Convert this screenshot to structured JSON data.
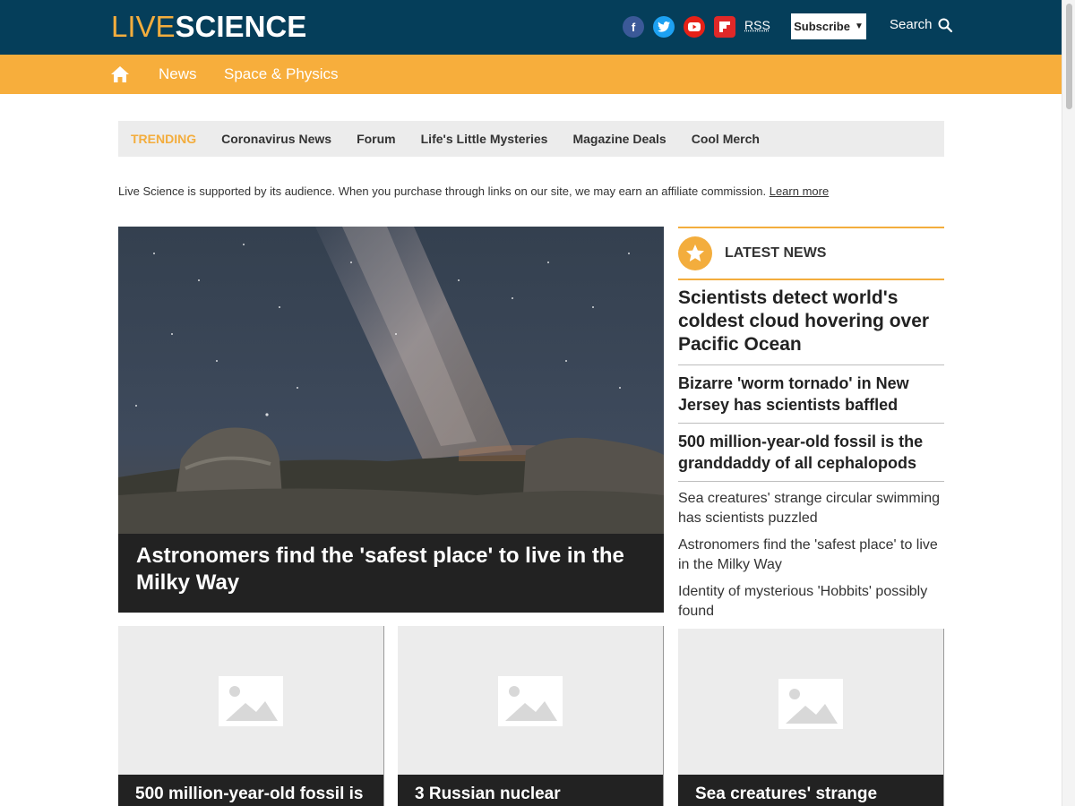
{
  "header": {
    "logo_live": "LIVE",
    "logo_science": "SCIENCE",
    "social": [
      {
        "name": "facebook",
        "glyph": "f",
        "color": "#3b5998"
      },
      {
        "name": "twitter",
        "glyph": "t",
        "color": "#1da1f2"
      },
      {
        "name": "youtube",
        "glyph": "▶",
        "color": "#e62117"
      },
      {
        "name": "flipboard",
        "glyph": "F",
        "color": "#e12828"
      }
    ],
    "rss_label": "RSS",
    "subscribe_label": "Subscribe",
    "search_label": "Search"
  },
  "nav": {
    "items": [
      "News",
      "Space & Physics"
    ]
  },
  "trending": {
    "label": "TRENDING",
    "items": [
      "Coronavirus News",
      "Forum",
      "Life's Little Mysteries",
      "Magazine Deals",
      "Cool Merch"
    ]
  },
  "affiliate": {
    "text": "Live Science is supported by its audience. When you purchase through links on our site, we may earn an affiliate commission.",
    "link": "Learn more"
  },
  "hero": {
    "headline": "Astronomers find the 'safest place' to live in the Milky Way"
  },
  "latest_news": {
    "title": "LATEST NEWS",
    "big_items": [
      "Scientists detect world's coldest cloud hovering over Pacific Ocean",
      "Bizarre 'worm tornado' in New Jersey has scientists baffled",
      "500 million-year-old fossil is the granddaddy of all cephalopods"
    ],
    "small_items": [
      "Sea creatures' strange circular swimming has scientists puzzled",
      "Astronomers find the 'safest place' to live in the Milky Way",
      "Identity of mysterious 'Hobbits' possibly found"
    ]
  },
  "cards": [
    {
      "caption": "500 million-year-old fossil is"
    },
    {
      "caption": "3 Russian nuclear"
    },
    {
      "caption": "Sea creatures' strange"
    }
  ],
  "colors": {
    "header_bg": "#053e5a",
    "accent": "#f7ae3c",
    "dark_caption": "#222222"
  }
}
